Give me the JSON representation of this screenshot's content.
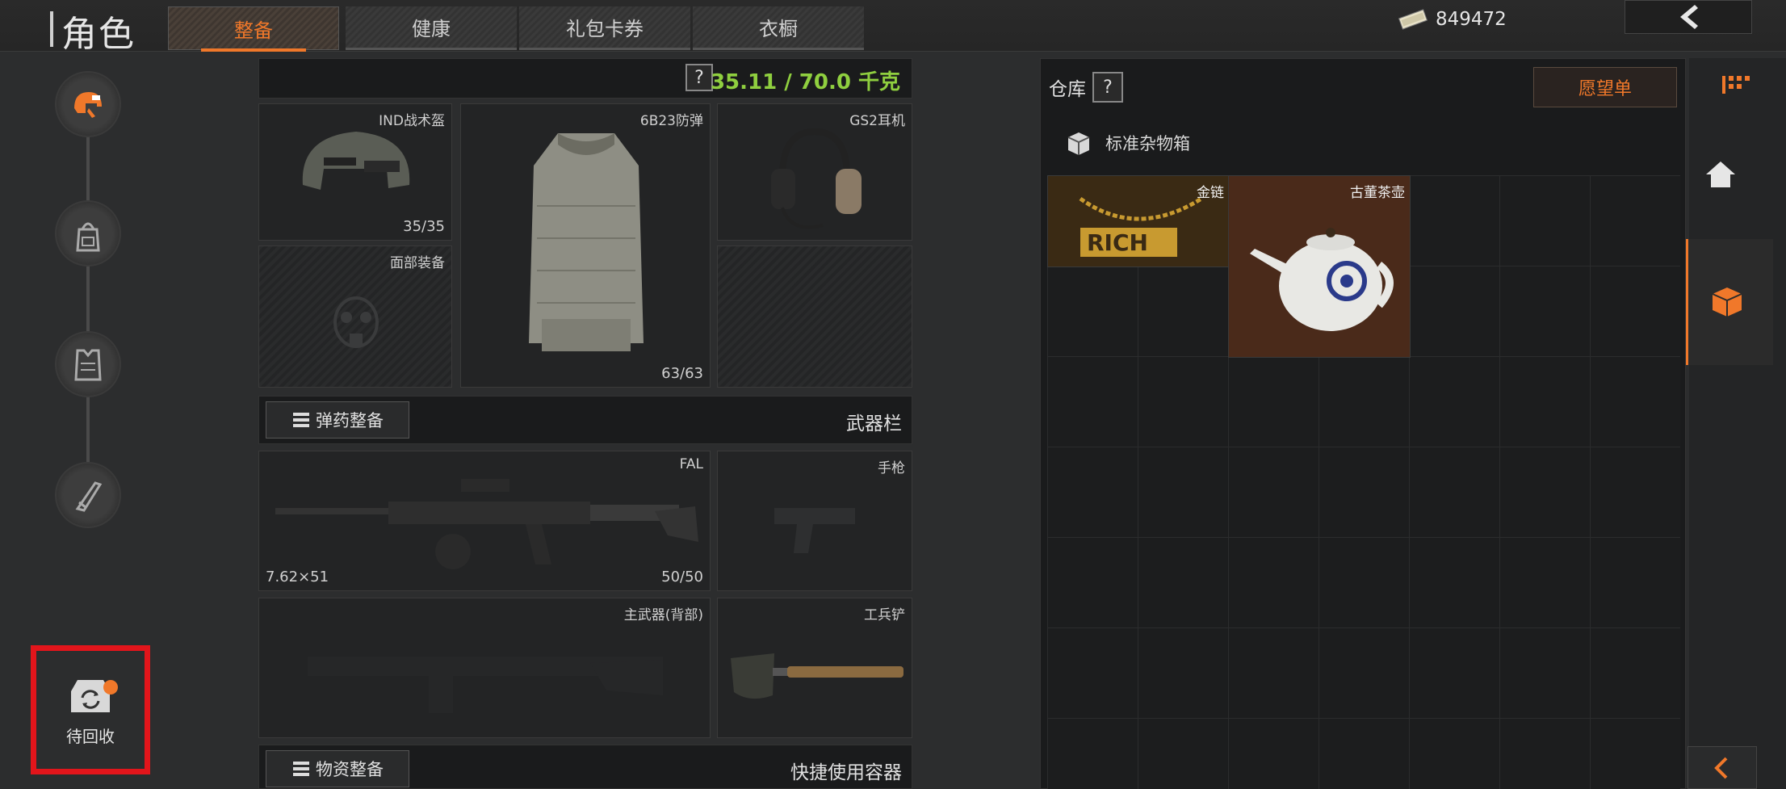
{
  "header": {
    "title": "角色",
    "tabs": [
      {
        "label": "整备",
        "active": true
      },
      {
        "label": "健康",
        "active": false
      },
      {
        "label": "礼包卡券",
        "active": false
      },
      {
        "label": "衣橱",
        "active": false
      }
    ],
    "money": "849472"
  },
  "left_rail": {
    "icons": [
      "helmet-gear-icon",
      "backpack-icon",
      "vest-icon",
      "knife-icon"
    ],
    "recycle_label": "待回收"
  },
  "equipment": {
    "help": "?",
    "weight": "35.11 / 70.0 千克",
    "helmet": {
      "label": "IND战术盔",
      "durability": "35/35"
    },
    "face": {
      "label": "面部装备"
    },
    "armor": {
      "label": "6B23防弹",
      "durability": "63/63"
    },
    "headset": {
      "label": "GS2耳机"
    },
    "ammo_button": "弹药整备",
    "weapons_title": "武器栏",
    "primary": {
      "label": "FAL",
      "caliber": "7.62×51",
      "ammo": "50/50"
    },
    "pistol": {
      "label": "手枪"
    },
    "back_weapon": {
      "label": "主武器(背部)"
    },
    "melee": {
      "label": "工兵铲"
    },
    "supply_button": "物资整备",
    "quick_title": "快捷使用容器"
  },
  "warehouse": {
    "title": "仓库",
    "help": "?",
    "wishlist": "愿望单",
    "container": "标准杂物箱",
    "items": [
      {
        "label": "金链",
        "tint": "#3a2a14"
      },
      {
        "label": "古董茶壶",
        "tint": "#4a2a1a"
      }
    ]
  },
  "colors": {
    "accent": "#f0782a",
    "weight_ok": "#8fcf3f",
    "highlight_red": "#e2151b"
  }
}
